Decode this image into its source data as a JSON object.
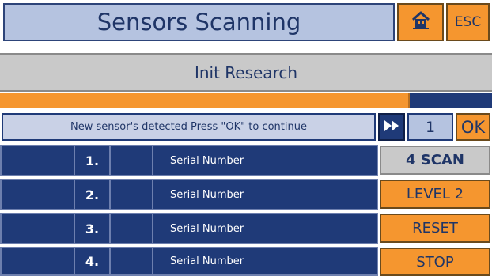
{
  "header": {
    "title": "Sensors Scanning",
    "esc_label": "ESC",
    "home_icon": "home-icon"
  },
  "subtitle": "Init Research",
  "progress": {
    "fraction": 0.83
  },
  "message": {
    "text": "New sensor's detected Press \"OK\" to continue",
    "count": "1",
    "ok_label": "OK",
    "ff_icon": "fast-forward-icon"
  },
  "rows": [
    {
      "num": "1.",
      "serial": "Serial Number"
    },
    {
      "num": "2.",
      "serial": "Serial Number"
    },
    {
      "num": "3.",
      "serial": "Serial Number"
    },
    {
      "num": "4.",
      "serial": "Serial Number"
    }
  ],
  "side_buttons": [
    {
      "label": "4 SCAN"
    },
    {
      "label": "LEVEL 2"
    },
    {
      "label": "RESET"
    },
    {
      "label": "STOP"
    }
  ],
  "colors": {
    "accent_orange": "#f5962f",
    "navy": "#1f3a78",
    "light_blue": "#b5c3e0",
    "grey": "#c9c9c9"
  }
}
